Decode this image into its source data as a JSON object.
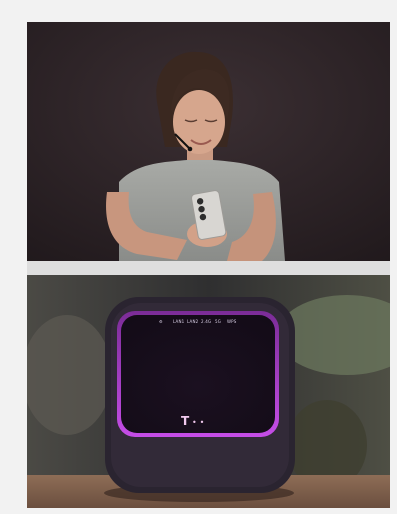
{
  "scene": {
    "top_photo": "person-looking-at-phone",
    "bottom_photo": "router-device"
  },
  "router": {
    "status_labels": [
      "⚙",
      "LAN1",
      "LAN2",
      "2.4G",
      "5G",
      "WPS"
    ],
    "brand_mark": "T",
    "brand_dots": "• •"
  },
  "colors": {
    "top_bg": "#2a2024",
    "router_glow": "#b53bd9",
    "router_body": "#2a2430",
    "table": "#8c6a52"
  }
}
